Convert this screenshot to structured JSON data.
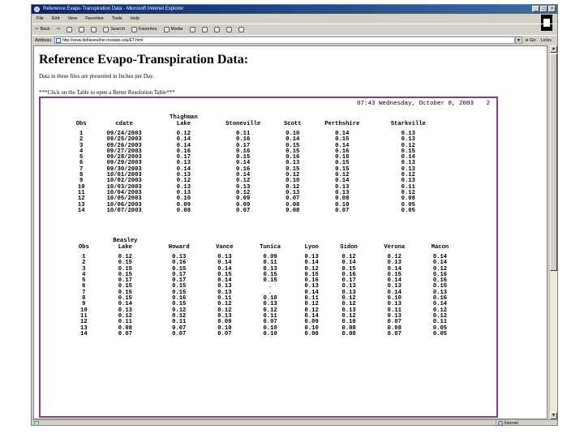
{
  "window": {
    "title": "Reference Evapo-Transpiration Data - Microsoft Internet Explorer",
    "buttons": [
      "_",
      "□",
      "×"
    ]
  },
  "menu": [
    "File",
    "Edit",
    "View",
    "Favorites",
    "Tools",
    "Help"
  ],
  "toolbar": {
    "back": "Back",
    "search": "Search",
    "favorites": "Favorites",
    "media": "Media"
  },
  "address": {
    "label": "Address",
    "url": "http://www.deltaweather.msstate.edu/ET.html",
    "go": "Go",
    "links": "Links"
  },
  "status": {
    "zone": "Internet"
  },
  "page": {
    "heading": "Reference Evapo-Transpiration Data:",
    "note": "Data in these files are presented in Inches per Day.",
    "click_note": "***Click on the Table to open a Better Resolution Table***",
    "report_stamp": "07:43 Wednesday, October 8, 2003",
    "report_page": "2"
  },
  "table1": {
    "headers": [
      [
        "",
        "Obs"
      ],
      [
        "",
        "cdate"
      ],
      [
        "Thighman",
        "Lake"
      ],
      [
        "",
        "Stoneville"
      ],
      [
        "",
        "Scott"
      ],
      [
        "",
        "Perthshire"
      ],
      [
        "",
        "Starkville"
      ]
    ],
    "rows": [
      [
        "1",
        "09/24/2003",
        "0.12",
        "0.11",
        "0.10",
        "0.14",
        "0.13"
      ],
      [
        "2",
        "09/25/2003",
        "0.14",
        "0.16",
        "0.14",
        "0.15",
        "0.13"
      ],
      [
        "3",
        "09/26/2003",
        "0.14",
        "0.17",
        "0.15",
        "0.14",
        "0.12"
      ],
      [
        "4",
        "09/27/2003",
        "0.16",
        "0.16",
        "0.15",
        "0.16",
        "0.15"
      ],
      [
        "5",
        "09/28/2003",
        "0.17",
        "0.15",
        "0.16",
        "0.18",
        "0.14"
      ],
      [
        "6",
        "09/29/2003",
        "0.13",
        "0.14",
        "0.13",
        "0.15",
        "0.13"
      ],
      [
        "7",
        "09/30/2003",
        "0.14",
        "0.16",
        "0.15",
        "0.15",
        "0.13"
      ],
      [
        "8",
        "10/01/2003",
        "0.13",
        "0.14",
        "0.12",
        "0.12",
        "0.12"
      ],
      [
        "9",
        "10/02/2003",
        "0.12",
        "0.12",
        "0.10",
        "0.14",
        "0.13"
      ],
      [
        "10",
        "10/03/2003",
        "0.13",
        "0.13",
        "0.12",
        "0.13",
        "0.11"
      ],
      [
        "11",
        "10/04/2003",
        "0.13",
        "0.12",
        "0.13",
        "0.13",
        "0.12"
      ],
      [
        "12",
        "10/05/2003",
        "0.10",
        "0.09",
        "0.07",
        "0.08",
        "0.08"
      ],
      [
        "13",
        "10/06/2003",
        "0.09",
        "0.09",
        "0.08",
        "0.10",
        "0.05"
      ],
      [
        "14",
        "10/07/2003",
        "0.08",
        "0.07",
        "0.08",
        "0.07",
        "0.05"
      ]
    ]
  },
  "table2": {
    "headers": [
      [
        "",
        "Obs"
      ],
      [
        "Beasley",
        "Lake"
      ],
      [
        "",
        "Howard"
      ],
      [
        "",
        "Vance"
      ],
      [
        "",
        "Tunica"
      ],
      [
        "",
        "Lyon"
      ],
      [
        "",
        "Sidon"
      ],
      [
        "",
        "Verona"
      ],
      [
        "",
        "Macon"
      ]
    ],
    "rows": [
      [
        "1",
        "0.12",
        "0.13",
        "0.13",
        "0.09",
        "0.13",
        "0.12",
        "0.12",
        "0.14"
      ],
      [
        "2",
        "0.15",
        "0.16",
        "0.14",
        "0.11",
        "0.14",
        "0.14",
        "0.13",
        "0.14"
      ],
      [
        "3",
        "0.15",
        "0.15",
        "0.14",
        "0.13",
        "0.12",
        "0.15",
        "0.14",
        "0.12"
      ],
      [
        "4",
        "0.15",
        "0.17",
        "0.15",
        "0.15",
        "0.15",
        "0.16",
        "0.15",
        "0.16"
      ],
      [
        "5",
        "0.17",
        "0.17",
        "0.14",
        "0.15",
        "0.16",
        "0.17",
        "0.14",
        "0.16"
      ],
      [
        "6",
        "0.15",
        "0.15",
        "0.13",
        ".",
        "0.13",
        "0.13",
        "0.13",
        "0.15"
      ],
      [
        "7",
        "0.15",
        "0.15",
        "0.13",
        ".",
        "0.14",
        "0.13",
        "0.14",
        "0.13"
      ],
      [
        "8",
        "0.15",
        "0.16",
        "0.11",
        "0.10",
        "0.11",
        "0.12",
        "0.10",
        "0.16"
      ],
      [
        "9",
        "0.14",
        "0.15",
        "0.12",
        "0.13",
        "0.12",
        "0.12",
        "0.13",
        "0.14"
      ],
      [
        "10",
        "0.13",
        "0.12",
        "0.12",
        "0.12",
        "0.12",
        "0.13",
        "0.11",
        "0.12"
      ],
      [
        "11",
        "0.12",
        "0.12",
        "0.13",
        "0.11",
        "0.14",
        "0.12",
        "0.13",
        "0.12"
      ],
      [
        "12",
        "0.11",
        "0.11",
        "0.09",
        "0.07",
        "0.09",
        "0.10",
        "0.07",
        "0.11"
      ],
      [
        "13",
        "0.08",
        "0.07",
        "0.10",
        "0.10",
        "0.10",
        "0.08",
        "0.08",
        "0.05"
      ],
      [
        "14",
        "0.07",
        "0.07",
        "0.07",
        "0.10",
        "0.08",
        "0.08",
        "0.07",
        "0.05"
      ]
    ]
  }
}
